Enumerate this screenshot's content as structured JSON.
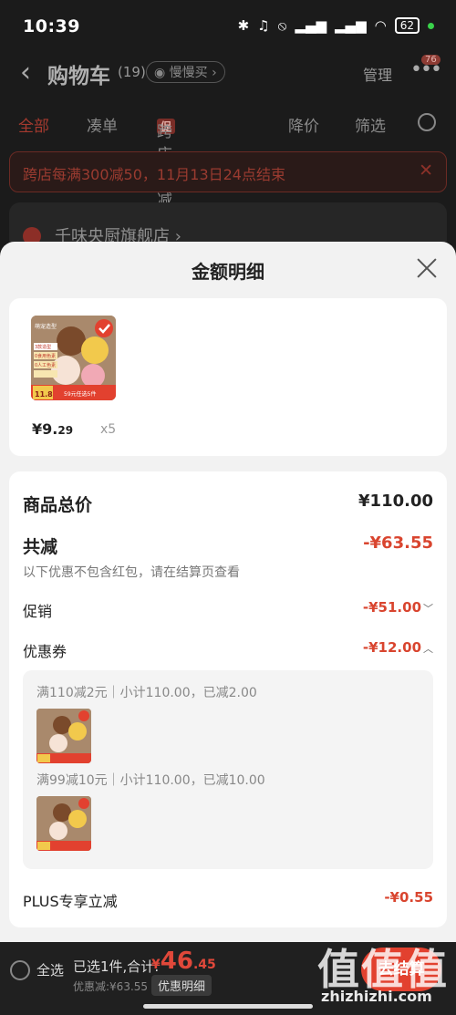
{
  "status_bar": {
    "time": "10:39",
    "battery": "62"
  },
  "cart_header": {
    "back": "‹",
    "title": "购物车",
    "count": "(19)",
    "slow_buy": "慢慢买",
    "manage": "管理",
    "more_badge": "76"
  },
  "filter_tabs": [
    "全部",
    "凑单",
    "跨店满减",
    "降价",
    "筛选"
  ],
  "promo_tag": "促",
  "banner": {
    "text": "跨店每满300减50，11月13日24点结束"
  },
  "store": {
    "name": "千味央厨旗舰店 ›"
  },
  "sheet": {
    "title": "金额明细",
    "item": {
      "price_int": "¥9.",
      "price_dec": "29",
      "qty": "x5",
      "thumb_tags": [
        "萌宠造型",
        "3款造型",
        "0食用色素",
        "0人工色素"
      ],
      "thumb_price": "11.8",
      "thumb_promo": "59元任选5件"
    },
    "summary": {
      "total_label": "商品总价",
      "total_value": "¥110.00",
      "reduce_label": "共减",
      "reduce_value": "-¥63.55",
      "note": "以下优惠不包含红包，请在结算页查看",
      "promo_label": "促销",
      "promo_value": "-¥51.00",
      "coupon_label": "优惠券",
      "coupon_value": "-¥12.00",
      "coupons": [
        {
          "text": "满110减2元｜小计110.00，已减2.00"
        },
        {
          "text": "满99减10元｜小计110.00，已减10.00"
        }
      ],
      "plus_label": "PLUS专享立减",
      "plus_value": "-¥0.55"
    }
  },
  "bottom_bar": {
    "select_all": "全选",
    "selected": "已选1件,合计:",
    "total_yen": "¥",
    "total_int": "46",
    "total_dec": ".45",
    "discount": "优惠减:¥63.55",
    "detail_btn": "优惠明细",
    "checkout": "去结算"
  },
  "watermark": {
    "big": "值值值",
    "small": "zhizhizhi.com"
  }
}
